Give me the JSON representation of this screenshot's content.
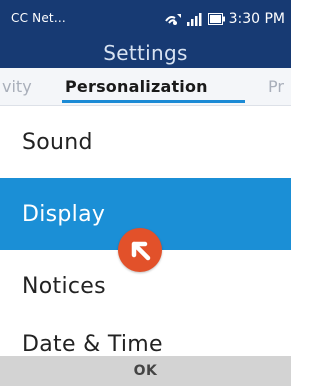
{
  "status_bar": {
    "carrier": "CC Net...",
    "time": "3:30 PM",
    "icons": [
      "wifi-calling-icon",
      "signal-icon",
      "battery-icon"
    ]
  },
  "header": {
    "title": "Settings"
  },
  "tabs": {
    "previous_label": "vity",
    "active_label": "Personalization",
    "next_label": "Pr"
  },
  "list": {
    "items": [
      {
        "label": "Sound",
        "selected": false
      },
      {
        "label": "Display",
        "selected": true
      },
      {
        "label": "Notices",
        "selected": false
      },
      {
        "label": "Date & Time",
        "selected": false
      }
    ]
  },
  "softkeys": {
    "center": "OK"
  },
  "colors": {
    "status_bar_bg": "#173a73",
    "selection": "#1b8fd6",
    "tab_underline": "#1b8ad5",
    "cursor_marker": "#e2512a",
    "softkey_bar_bg": "#d3d3d3"
  }
}
